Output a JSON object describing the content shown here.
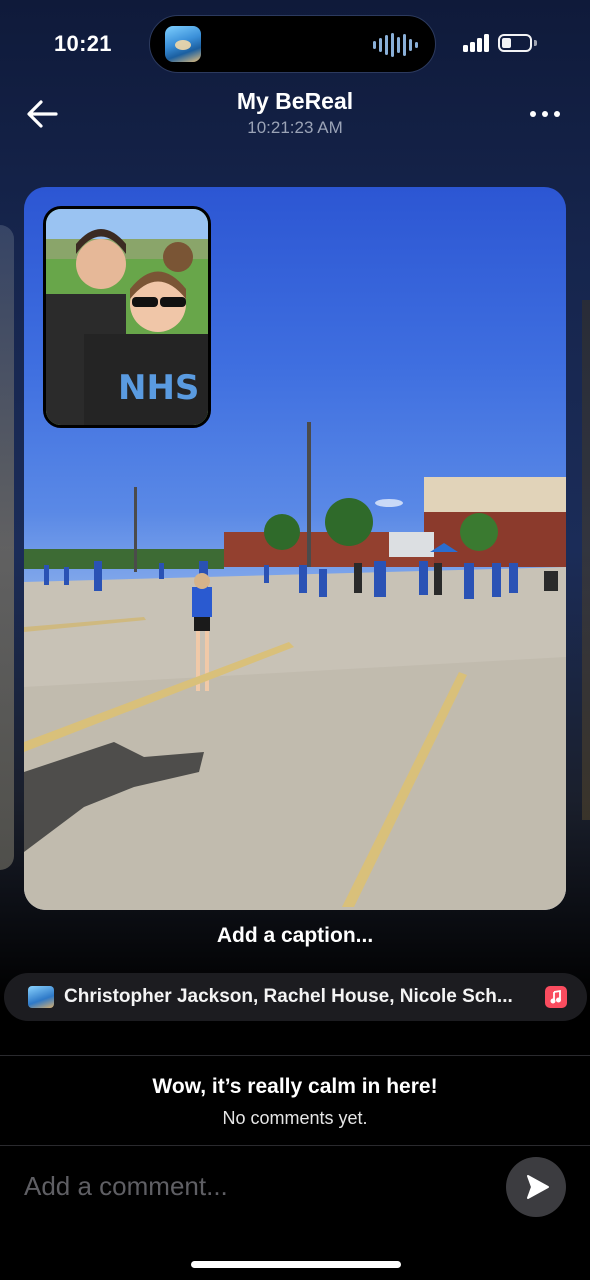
{
  "status_bar": {
    "time": "10:21",
    "island_icon": "now-playing-artwork",
    "signal_icon": "cellular-signal-icon",
    "battery_icon": "battery-icon",
    "battery_level": 0.35
  },
  "header": {
    "back_icon": "arrow-left-icon",
    "title": "My BeReal",
    "timestamp": "10:21:23 AM",
    "more_icon": "more-horizontal-icon"
  },
  "post": {
    "main_photo": "outdoor-parking-lot-event",
    "selfie_photo": "front-camera-selfie",
    "caption_prompt": "Add a caption..."
  },
  "music": {
    "artwork_icon": "album-art-icon",
    "track_text": "Christopher Jackson, Rachel House, Nicole Sch...",
    "service_icon": "apple-music-icon"
  },
  "comments": {
    "empty_title": "Wow, it’s really calm in here!",
    "empty_subtitle": "No comments yet.",
    "input_placeholder": "Add a comment...",
    "send_icon": "send-icon"
  },
  "colors": {
    "background": "#000000",
    "secondary_text": "#9aa3b6",
    "pill_background": "#1c1c20",
    "send_button": "#3c3c40",
    "music_badge": "#fa4c5f"
  }
}
